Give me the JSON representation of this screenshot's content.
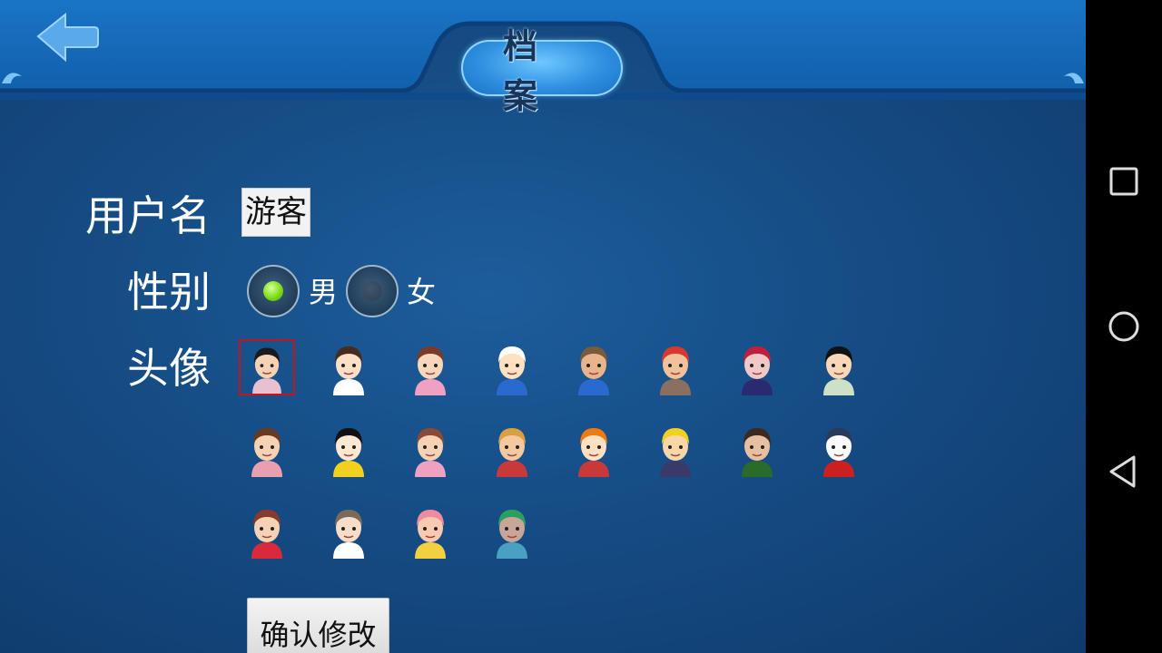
{
  "header": {
    "title": "档案",
    "back_icon": "back-arrow-icon"
  },
  "form": {
    "username_label": "用户名",
    "username_value": "游客",
    "gender_label": "性别",
    "gender_options": [
      {
        "label": "男",
        "selected": true
      },
      {
        "label": "女",
        "selected": false
      }
    ],
    "avatar_label": "头像",
    "avatars": [
      {
        "name": "avatar-boy-sunglasses",
        "selected": true
      },
      {
        "name": "avatar-girl-long-hair",
        "selected": false
      },
      {
        "name": "avatar-fairy-girl",
        "selected": false
      },
      {
        "name": "avatar-cap-boy",
        "selected": false
      },
      {
        "name": "avatar-cowgirl",
        "selected": false
      },
      {
        "name": "avatar-red-hat",
        "selected": false
      },
      {
        "name": "avatar-warrior-girl",
        "selected": false
      },
      {
        "name": "avatar-cartoon-man",
        "selected": false
      },
      {
        "name": "avatar-brown-hair-girl",
        "selected": false
      },
      {
        "name": "avatar-cartoon-boy",
        "selected": false
      },
      {
        "name": "avatar-pink-dress-girl",
        "selected": false
      },
      {
        "name": "avatar-straw-hat",
        "selected": false
      },
      {
        "name": "avatar-orange-helmet",
        "selected": false
      },
      {
        "name": "avatar-ninja",
        "selected": false
      },
      {
        "name": "avatar-eyepatch",
        "selected": false
      },
      {
        "name": "avatar-wizard-mouse",
        "selected": false
      },
      {
        "name": "avatar-red-coat-girl",
        "selected": false
      },
      {
        "name": "avatar-small-boy",
        "selected": false
      },
      {
        "name": "avatar-bottle-girl",
        "selected": false
      },
      {
        "name": "avatar-green-hat-pig",
        "selected": false
      }
    ],
    "confirm_label": "确认修改"
  },
  "colors": {
    "background": "#164e87",
    "header": "#1567b5",
    "selected_border": "#c4151c",
    "radio_on": "#7ddc18"
  },
  "navbar": {
    "icons": [
      "recent-apps-icon",
      "home-icon",
      "back-icon"
    ]
  }
}
